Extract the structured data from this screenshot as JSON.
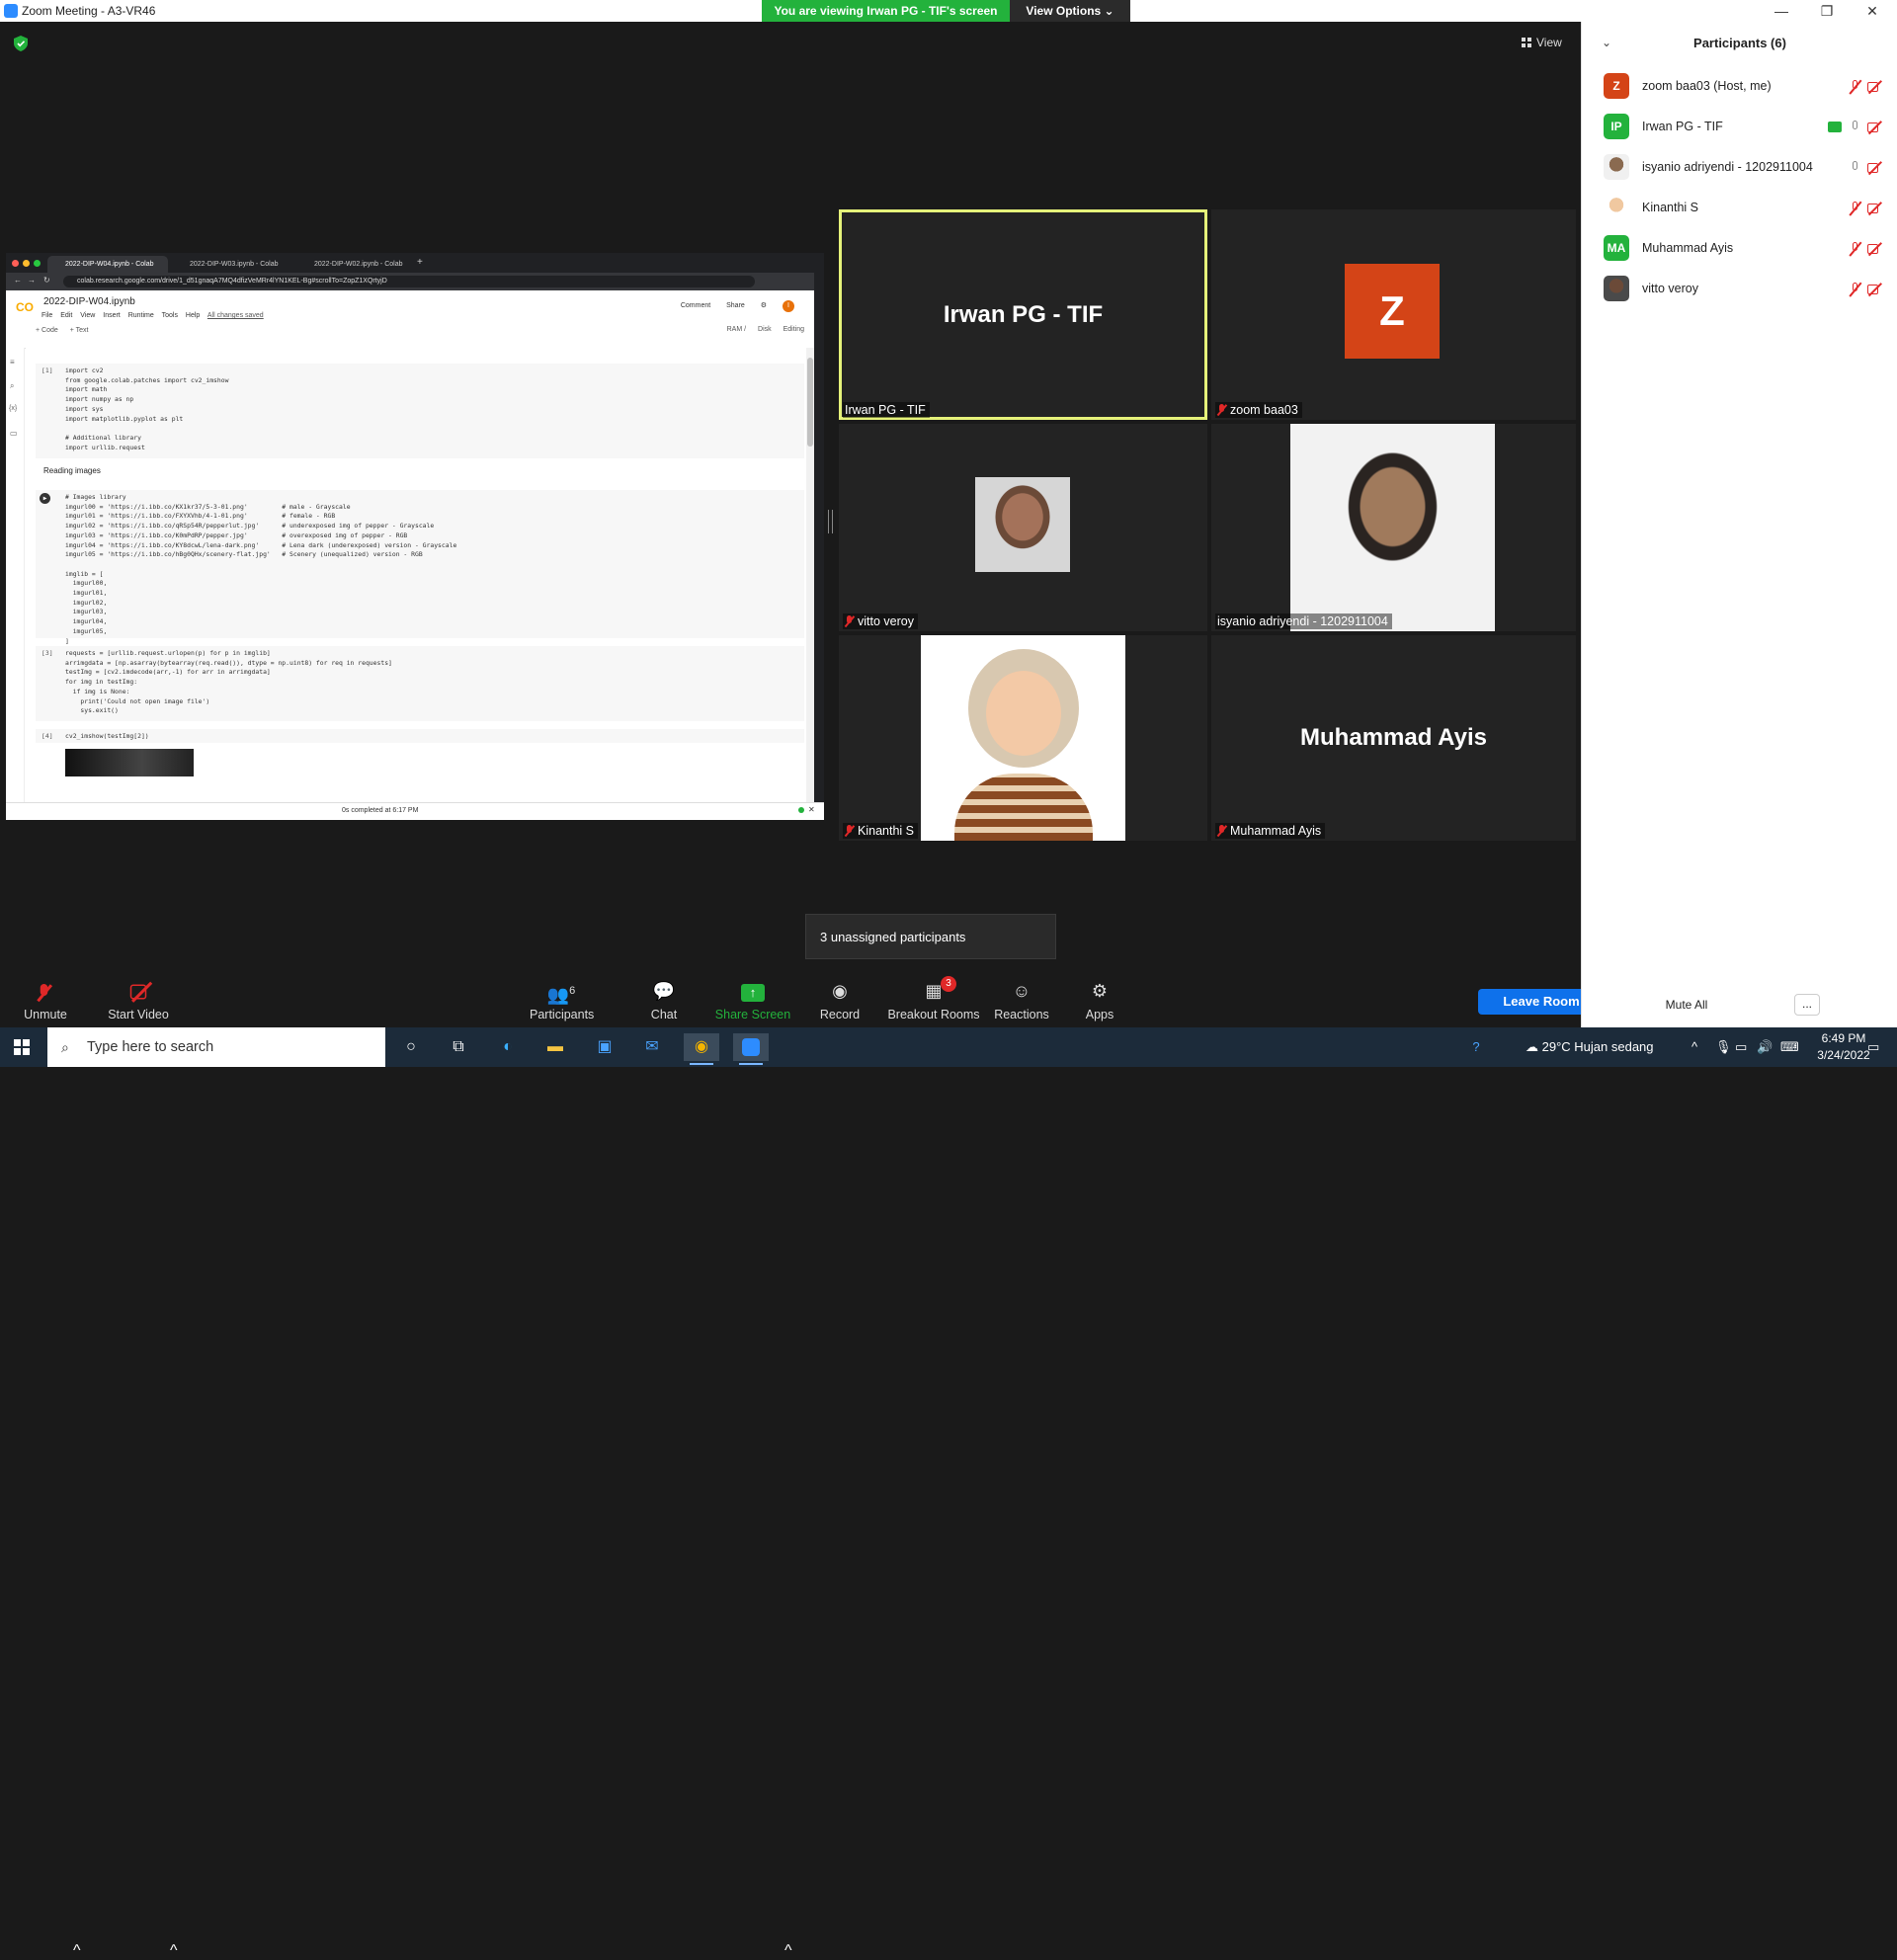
{
  "window": {
    "title": "Zoom Meeting - A3-VR46",
    "viewing_banner": "You are viewing Irwan PG - TIF's screen",
    "view_options": "View Options ⌄",
    "view_label": "View",
    "colors": {
      "banner_green": "#23b23c",
      "active_speaker_border": "#e5f27a",
      "leave_blue": "#0e71eb"
    }
  },
  "shared_screen": {
    "tabs": [
      "2022-DIP-W04.ipynb - Colab",
      "2022-DIP-W03.ipynb - Colab",
      "2022-DIP-W02.ipynb - Colab"
    ],
    "url": "colab.research.google.com/drive/1_d51gnaqA7MQ4dfizVeMRr4lYN1KEL-Bg#scrollTo=ZopZ1XQrtyjD",
    "notebook_name": "2022-DIP-W04.ipynb",
    "menu": [
      "File",
      "Edit",
      "View",
      "Insert",
      "Runtime",
      "Tools",
      "Help"
    ],
    "saved": "All changes saved",
    "toolbar": [
      "+ Code",
      "+ Text"
    ],
    "comment": "Comment",
    "share": "Share",
    "avatar": "I",
    "ram": "RAM",
    "disk": "Disk",
    "editing": "Editing",
    "cells": [
      {
        "num": "[1]",
        "code": "import cv2\nfrom google.colab.patches import cv2_imshow\nimport math\nimport numpy as np\nimport sys\nimport matplotlib.pyplot as plt\n\n# Additional library\nimport urllib.request"
      },
      {
        "num": "",
        "code": "# Images library\nimgurl00 = 'https://i.ibb.co/KX1kr37/5-3-01.png'         # male - Grayscale\nimgurl01 = 'https://i.ibb.co/FXYXVhb/4-1-01.png'         # female - RGB\nimgurl02 = 'https://i.ibb.co/qRSp54R/pepperlut.jpg'      # underexposed img of pepper - Grayscale\nimgurl03 = 'https://i.ibb.co/K0mPdRP/pepper.jpg'         # overexposed img of pepper - RGB\nimgurl04 = 'https://i.ibb.co/KY8dcwL/lena-dark.png'      # Lena dark (underexposed) version - Grayscale\nimgurl05 = 'https://i.ibb.co/hBg0QHx/scenery-flat.jpg'   # Scenery (unequalized) version - RGB\n\nimglib = [\n  imgurl00,\n  imgurl01,\n  imgurl02,\n  imgurl03,\n  imgurl04,\n  imgurl05,\n]"
      },
      {
        "num": "[3]",
        "code": "requests = [urllib.request.urlopen(p) for p in imglib]\narrimgdata = [np.asarray(bytearray(req.read()), dtype = np.uint8) for req in requests]\ntestImg = [cv2.imdecode(arr,-1) for arr in arrimgdata]\nfor img in testImg:\n  if img is None:\n    print('Could not open image file')\n    sys.exit()"
      },
      {
        "num": "[4]",
        "code": "cv2_imshow(testImg[2])"
      }
    ],
    "markdown_heading": "Reading images",
    "status": "0s   completed at 6:17 PM"
  },
  "tiles": [
    {
      "name": "Irwan PG - TIF",
      "label": "Irwan PG - TIF",
      "muted": false,
      "active": true
    },
    {
      "name": "zoom baa03",
      "label": "zoom baa03",
      "muted": true,
      "avatar": "Z",
      "avatar_color": "#d44417"
    },
    {
      "name": "vitto veroy",
      "label": "vitto veroy",
      "muted": true
    },
    {
      "name": "isyanio adriyendi - 1202911004",
      "label": "isyanio adriyendi - 1202911004",
      "muted": false
    },
    {
      "name": "Kinanthi S",
      "label": "Kinanthi S",
      "muted": true
    },
    {
      "name": "Muhammad Ayis",
      "label": "Muhammad Ayis",
      "muted": true
    }
  ],
  "unassigned": "3 unassigned participants",
  "toolbar": {
    "unmute": "Unmute",
    "start_video": "Start Video",
    "participants": "Participants",
    "participants_count": "6",
    "chat": "Chat",
    "share_screen": "Share Screen",
    "record": "Record",
    "breakout_rooms": "Breakout Rooms",
    "breakout_badge": "3",
    "reactions": "Reactions",
    "apps": "Apps",
    "leave_room": "Leave Room"
  },
  "panel": {
    "title": "Participants (6)",
    "participants": [
      {
        "name": "zoom baa03 (Host, me)",
        "initials": "Z",
        "color": "#d44417",
        "mic": "off",
        "sharing": false
      },
      {
        "name": "Irwan PG - TIF",
        "initials": "IP",
        "color": "#23b23c",
        "mic": "on",
        "sharing": true
      },
      {
        "name": "isyanio adriyendi - 1202911004",
        "initials": "",
        "color": "#c9b8a8",
        "mic": "on",
        "sharing": false
      },
      {
        "name": "Kinanthi S",
        "initials": "",
        "color": "#e8c9a8",
        "mic": "off",
        "sharing": false
      },
      {
        "name": "Muhammad Ayis",
        "initials": "MA",
        "color": "#23b23c",
        "mic": "off",
        "sharing": false
      },
      {
        "name": "vitto veroy",
        "initials": "",
        "color": "#5a5a5a",
        "mic": "off",
        "sharing": false
      }
    ],
    "mute_all": "Mute All",
    "more": "..."
  },
  "taskbar": {
    "search_placeholder": "Type here to search",
    "weather": "29°C  Hujan sedang",
    "time": "6:49 PM",
    "date": "3/24/2022"
  }
}
